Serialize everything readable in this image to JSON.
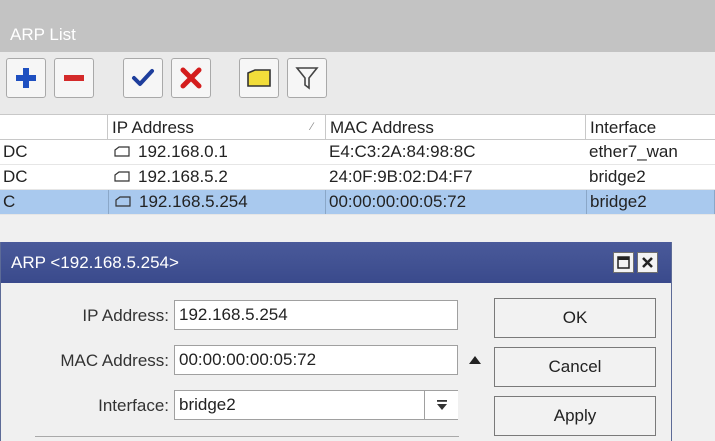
{
  "list_window": {
    "title": "ARP List"
  },
  "toolbar": {
    "buttons": [
      {
        "name": "add-icon",
        "color": "#1e4fc0"
      },
      {
        "name": "remove-icon",
        "color": "#d42a2a"
      },
      {
        "name": "enable-check-icon",
        "color": "#1e3e9c"
      },
      {
        "name": "disable-x-icon",
        "color": "#d41c1c"
      },
      {
        "name": "comment-note-icon",
        "color": "#f2dd3a"
      },
      {
        "name": "filter-funnel-icon",
        "color": "#555555"
      }
    ]
  },
  "table": {
    "columns": [
      "",
      "IP Address",
      "MAC Address",
      "Interface"
    ],
    "rows": [
      {
        "flags": "DC",
        "ip": "192.168.0.1",
        "mac": "E4:C3:2A:84:98:8C",
        "interface": "ether7_wan",
        "selected": false
      },
      {
        "flags": "DC",
        "ip": "192.168.5.2",
        "mac": "24:0F:9B:02:D4:F7",
        "interface": "bridge2",
        "selected": false
      },
      {
        "flags": "C",
        "ip": "192.168.5.254",
        "mac": "00:00:00:00:05:72",
        "interface": "bridge2",
        "selected": true
      }
    ],
    "selected_color": "#a9c9ee"
  },
  "dialog": {
    "title": "ARP <192.168.5.254>",
    "fields": {
      "ip_label": "IP Address:",
      "ip_value": "192.168.5.254",
      "mac_label": "MAC Address:",
      "mac_value": "00:00:00:00:05:72",
      "interface_label": "Interface:",
      "interface_value": "bridge2"
    },
    "buttons": {
      "ok": "OK",
      "cancel": "Cancel",
      "apply": "Apply"
    },
    "titlebar_color": "#3f4f90"
  }
}
